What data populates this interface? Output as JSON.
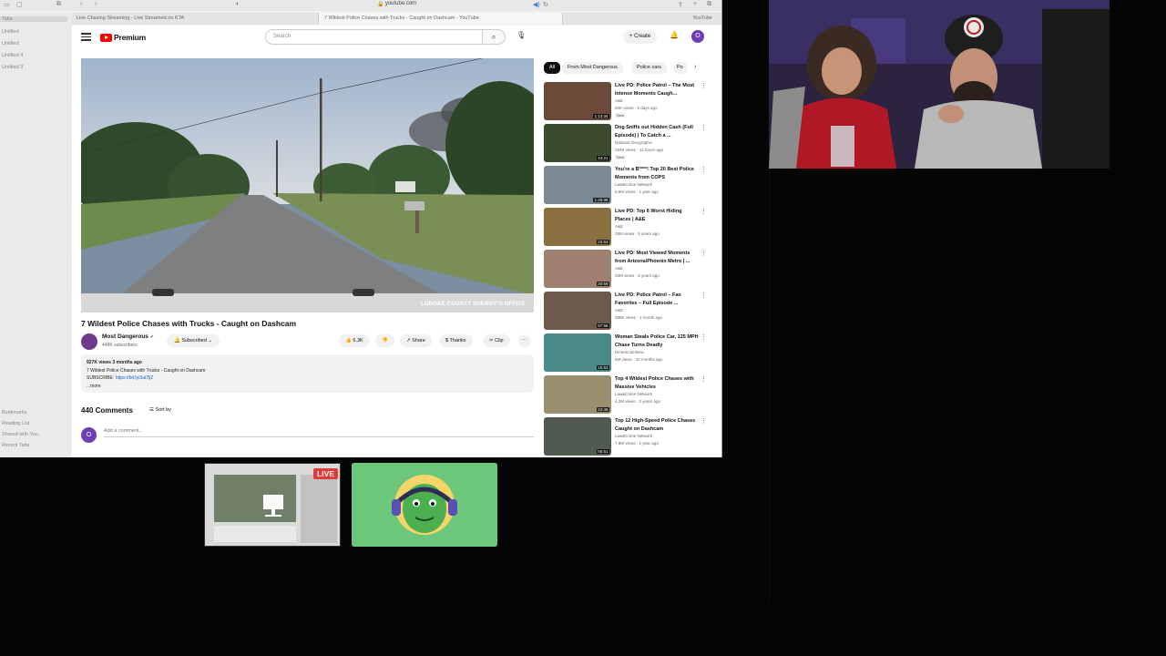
{
  "browser": {
    "url": "youtube.com",
    "tabs": [
      {
        "label": "Live Chasing Streaming - Live Streamed on KTA",
        "active": false
      },
      {
        "label": "7 Wildest Police Chases with Trucks - Caught on Dashcam - YouTube",
        "active": true
      },
      {
        "label": "YouTube",
        "active": false
      }
    ]
  },
  "sidebar": {
    "items": [
      "Tabs",
      "Untitled",
      "Untitled",
      "Untitled 4",
      "Untitled 3",
      "Bookmarks",
      "Reading List",
      "Shared with You",
      "Recent Tabs"
    ]
  },
  "header": {
    "logo_text": "Premium",
    "search_placeholder": "Search",
    "create_label": "+ Create",
    "avatar_letter": "O"
  },
  "video": {
    "watermark": "LONOKE COUNTY SHERIFF'S OFFICE",
    "title": "7 Wildest Police Chases with Trucks - Caught on Dashcam",
    "channel": "Most Dangerous",
    "subscribers": "448K subscribers",
    "subscribe_label": "Subscribed",
    "likes": "6.3K",
    "share_label": "Share",
    "thanks_label": "Thanks",
    "clip_label": "Clip",
    "views_date": "927K views  3 months ago",
    "description": "7 Wildest Police Chases with Trucks - Caught on Dashcam",
    "subscribe_line": "SUBSCRIBE: ",
    "subscribe_link": "https://bit.ly/3at7ljZ",
    "more": "...more",
    "comments_count": "440 Comments",
    "sort_label": "Sort by",
    "add_comment": "Add a comment...",
    "comment_avatar": "O"
  },
  "chips": [
    "All",
    "From Most Dangerous",
    "Police cars",
    "Po"
  ],
  "recommendations": [
    {
      "title": "Live PD: Police Patrol – The Most Intense Moments Caugh...",
      "channel": "A&E",
      "meta": "93K views · 5 days ago",
      "badge": "New",
      "duration": "1:13:34",
      "thumb": "#6b4a3a"
    },
    {
      "title": "Dog Sniffs out Hidden Cash (Full Episode) | To Catch a ...",
      "channel": "National Geographic",
      "meta": "184K views · 11 hours ago",
      "badge": "New",
      "duration": "44:21",
      "thumb": "#3b4b2e"
    },
    {
      "title": "You're a B****! Top 20 Best Police Moments from COPS",
      "channel": "Law&Crime Network",
      "meta": "6.9M views · 1 year ago",
      "badge": "",
      "duration": "1:20:38",
      "thumb": "#7b8a95"
    },
    {
      "title": "Live PD: Top 6 Worst Hiding Places | A&E",
      "channel": "A&E",
      "meta": "19M views · 5 years ago",
      "badge": "",
      "duration": "23:53",
      "thumb": "#8a7040"
    },
    {
      "title": "Live PD: Most Viewed Moments from Arizona/Phoenix Metro | ...",
      "channel": "A&E",
      "meta": "25M views · 6 years ago",
      "badge": "",
      "duration": "20:59",
      "thumb": "#a08070"
    },
    {
      "title": "Live PD: Police Patrol – Fan Favorites – Full Episode ...",
      "channel": "A&E",
      "meta": "388K views · 1 month ago",
      "badge": "",
      "duration": "57:56",
      "thumb": "#6e5a4c"
    },
    {
      "title": "Woman Steals Police Car, 125 MPH Chase Turns Deadly",
      "channel": "DinnerCamNow",
      "meta": "5M views · 10 months ago",
      "badge": "",
      "duration": "15:53",
      "thumb": "#4a8a8a"
    },
    {
      "title": "Top 4 Wildest Police Chases with Massive Vehicles",
      "channel": "Law&Crime Network",
      "meta": "4.2M views · 2 years ago",
      "badge": "",
      "duration": "24:46",
      "thumb": "#9a9070"
    },
    {
      "title": "Top 12 High-Speed Police Chases Caught on Dashcam",
      "channel": "Law&Crime Network",
      "meta": "7.9M views · 1 year ago",
      "badge": "",
      "duration": "56:51",
      "thumb": "#505a50"
    }
  ],
  "live_badge": "LIVE"
}
